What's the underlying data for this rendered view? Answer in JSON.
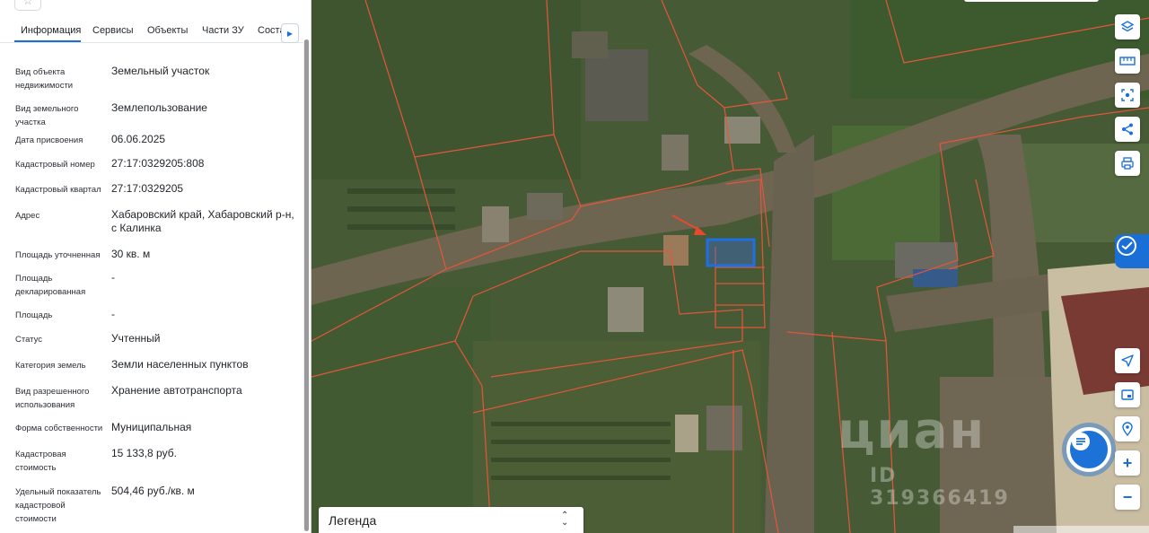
{
  "tabs": [
    {
      "label": "Информация",
      "active": true
    },
    {
      "label": "Сервисы"
    },
    {
      "label": "Объекты"
    },
    {
      "label": "Части ЗУ"
    },
    {
      "label": "Соста"
    }
  ],
  "properties": [
    {
      "label": "Вид объекта недвижимости",
      "value": "Земельный участок"
    },
    {
      "label": "Вид земельного участка",
      "value": "Землепользование"
    },
    {
      "label": "Дата присвоения",
      "value": "06.06.2025"
    },
    {
      "label": "Кадастровый номер",
      "value": "27:17:0329205:808"
    },
    {
      "label": "Кадастровый квартал",
      "value": "27:17:0329205"
    },
    {
      "label": "Адрес",
      "value": "Хабаровский край, Хабаровский р-н, с Калинка"
    },
    {
      "label": "Площадь уточненная",
      "value": "30 кв. м"
    },
    {
      "label": "Площадь декларированная",
      "value": "-"
    },
    {
      "label": "Площадь",
      "value": "-"
    },
    {
      "label": "Статус",
      "value": "Учтенный"
    },
    {
      "label": "Категория земель",
      "value": "Земли населенных пунктов"
    },
    {
      "label": "Вид разрешенного использования",
      "value": "Хранение автотранспорта"
    },
    {
      "label": "Форма собственности",
      "value": "Муниципальная"
    },
    {
      "label": "Кадастровая стоимость",
      "value": "15 133,8 руб."
    },
    {
      "label": "Удельный показатель кадастровой стоимости",
      "value": "504,46 руб./кв. м"
    }
  ],
  "legend": {
    "label": "Легенда"
  },
  "watermark": {
    "logo": "циан",
    "id": "ID 319366419"
  },
  "map_controls": [
    {
      "name": "layers-icon"
    },
    {
      "name": "ruler-icon"
    },
    {
      "name": "select-area-icon"
    },
    {
      "name": "share-icon"
    },
    {
      "name": "print-icon"
    },
    {
      "name": "locate-icon"
    },
    {
      "name": "minimap-icon"
    },
    {
      "name": "pin-icon"
    }
  ],
  "zoom": {
    "in": "+",
    "out": "−"
  },
  "colors": {
    "accent": "#1a6fd6",
    "parcel_border": "#e5563a",
    "selected_parcel": "#1f6fe0"
  }
}
